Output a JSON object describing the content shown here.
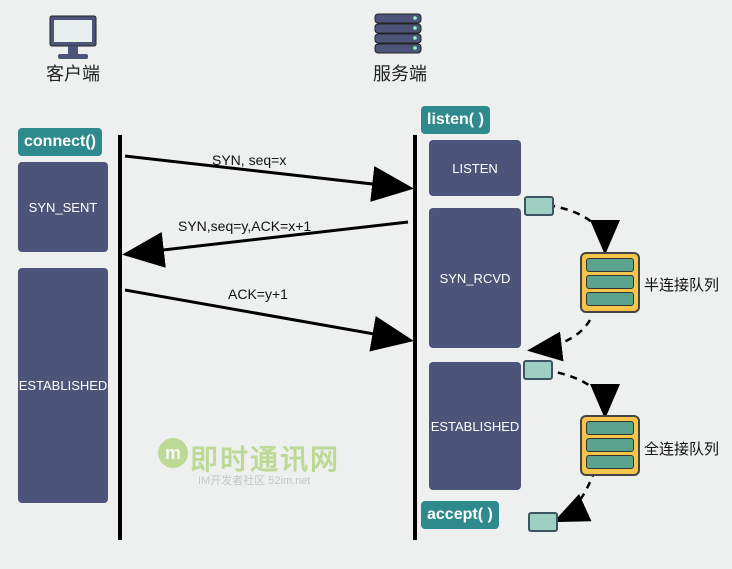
{
  "headers": {
    "client": "客户端",
    "server": "服务端"
  },
  "client": {
    "connect": "connect()",
    "states": {
      "syn_sent": "SYN_SENT",
      "established": "ESTABLISHED"
    }
  },
  "server": {
    "listen": "listen( )",
    "accept": "accept( )",
    "states": {
      "listen": "LISTEN",
      "syn_rcvd": "SYN_RCVD",
      "established": "ESTABLISHED"
    }
  },
  "messages": {
    "syn": "SYN,  seq=x",
    "synack": "SYN,seq=y,ACK=x+1",
    "ack": "ACK=y+1"
  },
  "queues": {
    "half": "半连接队列",
    "full": "全连接队列"
  },
  "watermark": {
    "main": "即时通讯网",
    "sub": "IM开发者社区  52im.net"
  }
}
